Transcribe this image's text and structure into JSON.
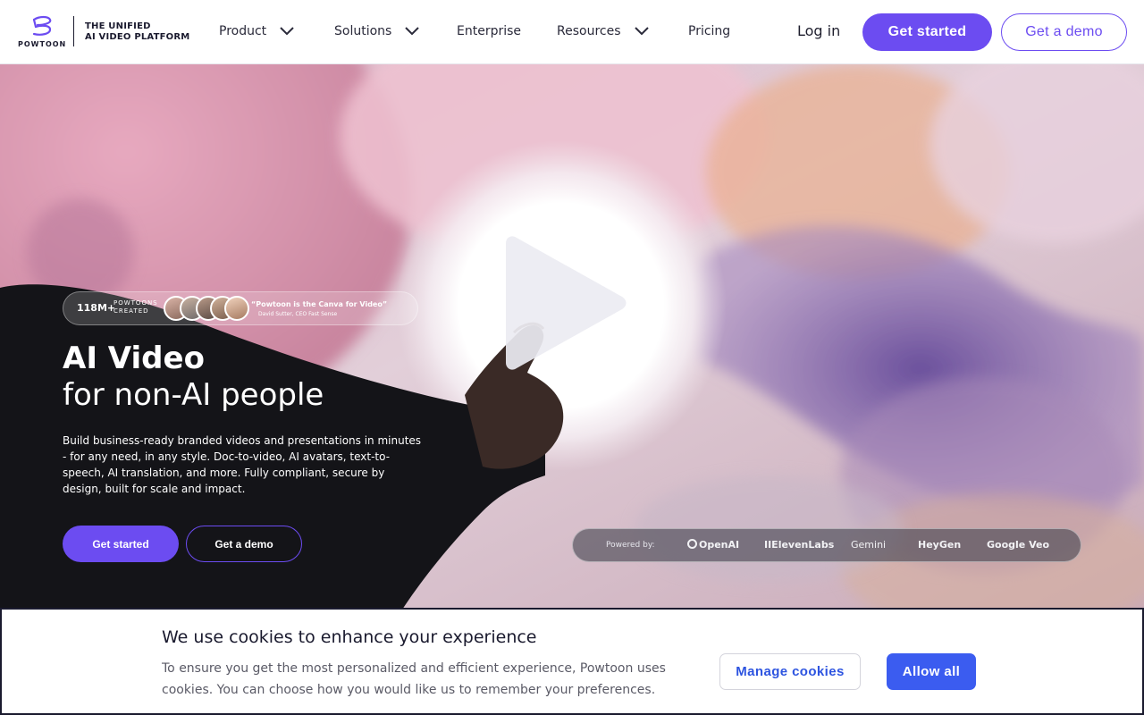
{
  "header": {
    "logo_text": "POWTOON",
    "tagline_line1": "THE UNIFIED",
    "tagline_line2": "AI VIDEO PLATFORM",
    "nav": [
      {
        "label": "Product",
        "has_dropdown": true
      },
      {
        "label": "Solutions",
        "has_dropdown": true
      },
      {
        "label": "Enterprise",
        "has_dropdown": false
      },
      {
        "label": "Resources",
        "has_dropdown": true
      },
      {
        "label": "Pricing",
        "has_dropdown": false
      }
    ],
    "login_label": "Log in",
    "get_started_label": "Get started",
    "get_demo_label": "Get a demo"
  },
  "hero": {
    "stats_count": "118M+",
    "stats_label_line1": "POWTOONS",
    "stats_label_line2": "CREATED",
    "quote": "“Powtoon is the Canva for Video”",
    "quote_author": "David Sutter, CEO Fast Sense",
    "title_line1": "AI Video",
    "title_line2": "for non-AI people",
    "description": "Build business-ready branded videos and presentations in minutes - for any need, in any style. Doc-to-video, AI avatars, text-to-speech, AI translation, and more. Fully compliant, secure by design, built for scale and impact.",
    "get_started_label": "Get started",
    "get_demo_label": "Get a demo",
    "powered_by_label": "Powered by:",
    "partners": [
      "OpenAI",
      "IIElevenLabs",
      "Gemini",
      "HeyGen",
      "Google Veo"
    ]
  },
  "cookie": {
    "title": "We use cookies to enhance your experience",
    "text": "To ensure you get the most personalized and efficient experience, Powtoon uses cookies. You can choose how you would like us to remember your preferences.",
    "manage_label": "Manage cookies",
    "allow_label": "Allow all"
  },
  "colors": {
    "brand_purple": "#6c4cf1",
    "cookie_blue": "#3b5cf0",
    "text_dark": "#1a1a2e"
  },
  "icons": [
    "powtoon-logo-icon",
    "chevron-down-icon",
    "play-icon",
    "openai-icon"
  ]
}
